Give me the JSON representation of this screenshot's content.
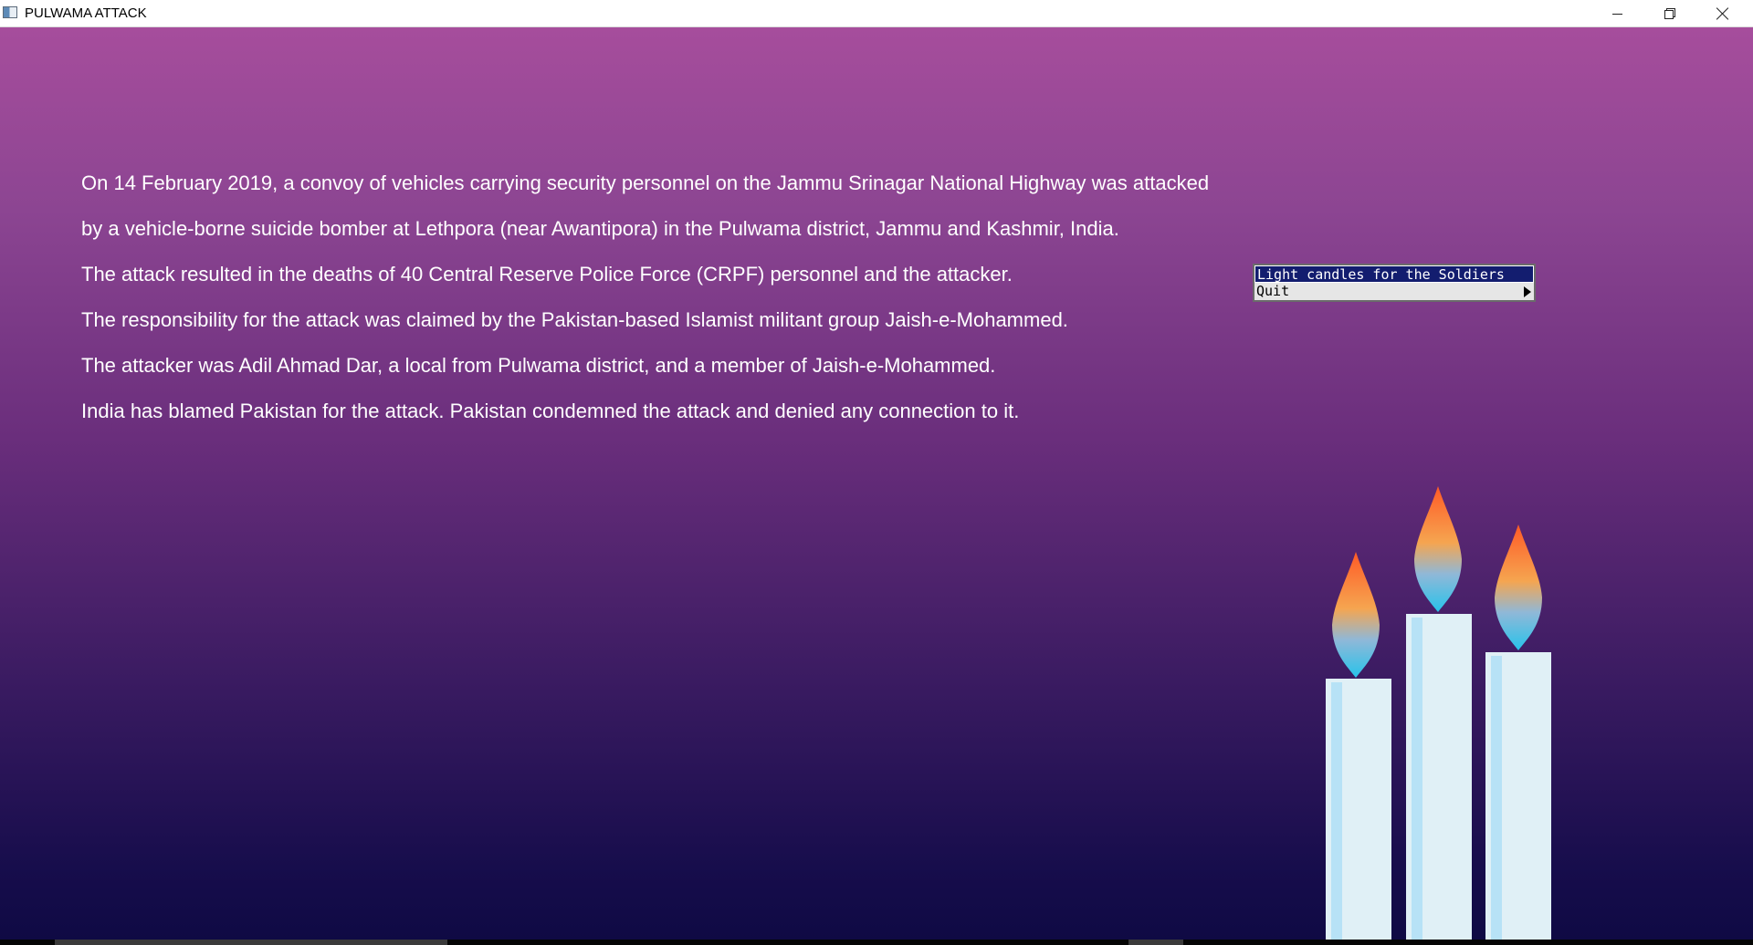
{
  "window": {
    "title": "PULWAMA ATTACK",
    "controls": [
      "minimize-icon",
      "restore-icon",
      "close-icon"
    ]
  },
  "text_lines": [
    "On 14 February 2019, a convoy of vehicles carrying security personnel on the Jammu Srinagar National Highway was attacked",
    "by a vehicle-borne suicide bomber at Lethpora (near Awantipora) in the Pulwama district, Jammu and Kashmir, India.",
    "The attack resulted in the deaths of 40 Central Reserve Police Force (CRPF) personnel and the attacker.",
    "The responsibility for the attack was claimed by the Pakistan-based Islamist militant group Jaish-e-Mohammed.",
    "The attacker was Adil Ahmad Dar, a local from Pulwama district, and a member of Jaish-e-Mohammed.",
    "India has blamed Pakistan for the attack.  Pakistan condemned the attack and denied any connection to it."
  ],
  "popup_menu": {
    "items": [
      {
        "label": "Light candles for the Soldiers",
        "highlighted": true
      },
      {
        "label": "Quit",
        "has_submenu": true
      }
    ]
  },
  "candles": {
    "count": 3,
    "colors": {
      "wax": "#e0f0f6",
      "wax_stripe": "#b7e2f6",
      "flame_top": "#ff6a2a",
      "flame_bottom": "#2ec4e8"
    }
  },
  "colors": {
    "background_top": "#a64d9c",
    "background_bottom": "#0f0a44",
    "text": "#ffffff",
    "menu_highlight": "#131d6f"
  }
}
